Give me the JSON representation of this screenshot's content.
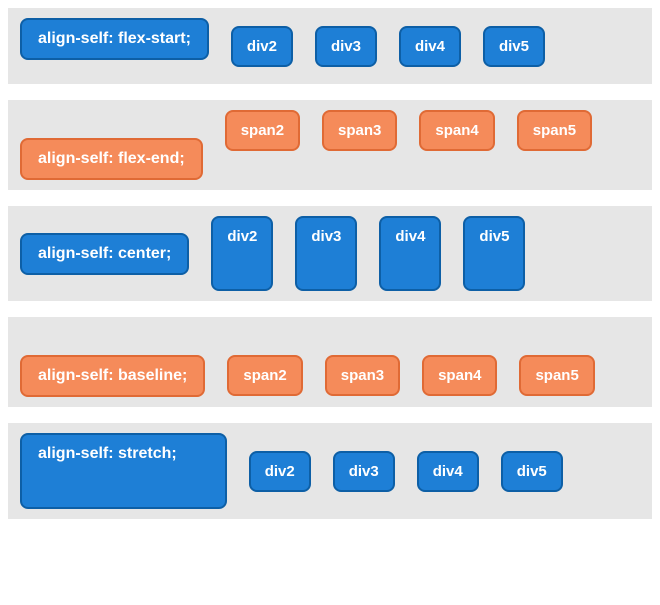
{
  "examples": [
    {
      "label": "align-self: flex-start;",
      "labelColor": "blue",
      "itemColor": "blue-item",
      "items": [
        "div2",
        "div3",
        "div4",
        "div5"
      ]
    },
    {
      "label": "align-self: flex-end;",
      "labelColor": "orange",
      "itemColor": "orange-item",
      "items": [
        "span2",
        "span3",
        "span4",
        "span5"
      ]
    },
    {
      "label": "align-self: center;",
      "labelColor": "blue",
      "itemColor": "blue-item",
      "items": [
        "div2",
        "div3",
        "div4",
        "div5"
      ]
    },
    {
      "label": "align-self: baseline;",
      "labelColor": "orange",
      "itemColor": "orange-item",
      "items": [
        "span2",
        "span3",
        "span4",
        "span5"
      ]
    },
    {
      "label": "align-self: stretch;",
      "labelColor": "blue",
      "itemColor": "blue-item",
      "items": [
        "div2",
        "div3",
        "div4",
        "div5"
      ]
    }
  ]
}
